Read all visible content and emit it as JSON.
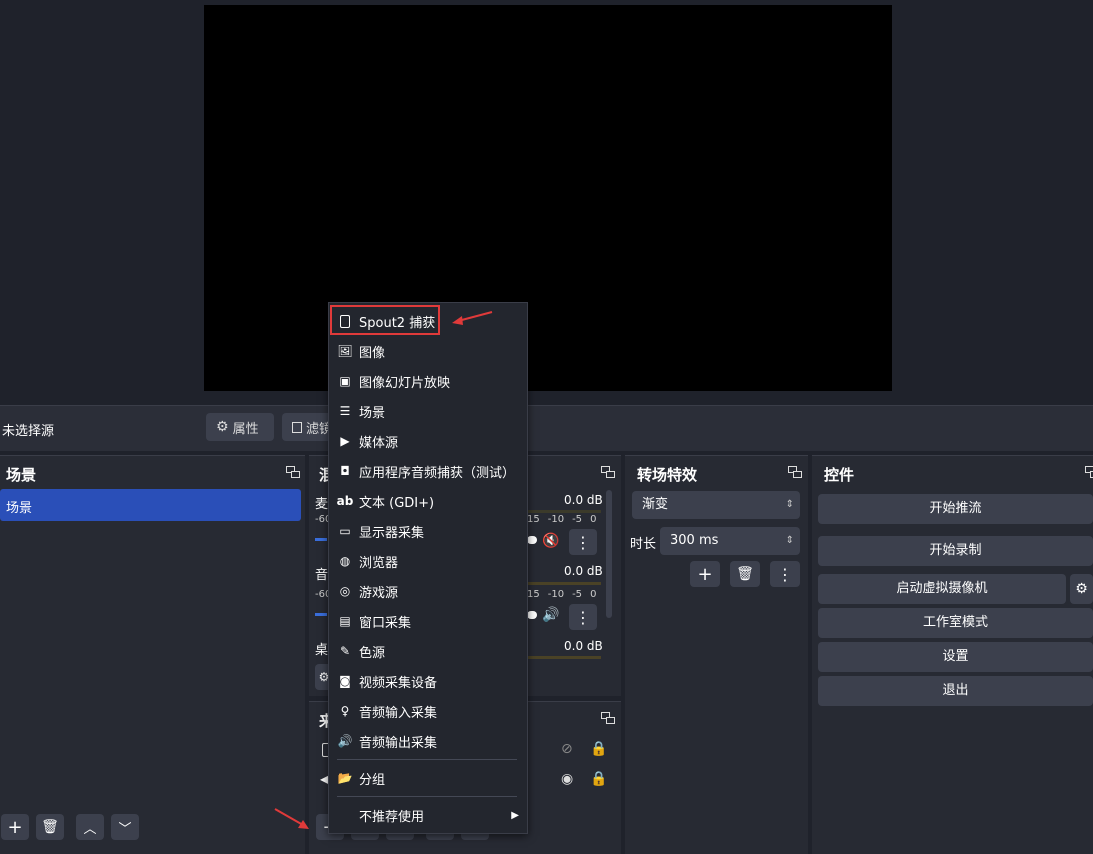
{
  "toolbar": {
    "no_source": "未选择源",
    "properties": "属性",
    "filters": "滤镜"
  },
  "scenes": {
    "title": "场景",
    "items": [
      {
        "label": "场景"
      }
    ]
  },
  "mixer": {
    "title_fragment": "混",
    "channels": [
      {
        "label_fragment": "麦",
        "db": "0.0 dB",
        "scale_left": "-60",
        "scale": [
          "15",
          "-10",
          "-5",
          "0"
        ]
      },
      {
        "label_fragment": "音",
        "db": "0.0 dB",
        "scale_left": "-60",
        "scale": [
          "15",
          "-10",
          "-5",
          "0"
        ]
      },
      {
        "label_fragment": "桌",
        "db": "0.0 dB"
      }
    ]
  },
  "sources": {
    "title_fragment": "来"
  },
  "transitions": {
    "title": "转场特效",
    "selected": "渐变",
    "duration_label": "时长",
    "duration_value": "300 ms"
  },
  "controls": {
    "title": "控件",
    "buttons": [
      "开始推流",
      "开始录制",
      "启动虚拟摄像机",
      "工作室模式",
      "设置",
      "退出"
    ]
  },
  "context_menu": {
    "items": [
      {
        "label": "Spout2 捕获",
        "icon": "file-icon"
      },
      {
        "label": "图像",
        "icon": "image-icon"
      },
      {
        "label": "图像幻灯片放映",
        "icon": "slideshow-icon"
      },
      {
        "label": "场景",
        "icon": "list-icon"
      },
      {
        "label": "媒体源",
        "icon": "play-icon"
      },
      {
        "label": "应用程序音频捕获（测试）",
        "icon": "app-audio-icon"
      },
      {
        "label": "文本 (GDI+)",
        "icon": "text-icon"
      },
      {
        "label": "显示器采集",
        "icon": "monitor-icon"
      },
      {
        "label": "浏览器",
        "icon": "globe-icon"
      },
      {
        "label": "游戏源",
        "icon": "gamepad-icon"
      },
      {
        "label": "窗口采集",
        "icon": "window-icon"
      },
      {
        "label": "色源",
        "icon": "brush-icon"
      },
      {
        "label": "视频采集设备",
        "icon": "camera-icon"
      },
      {
        "label": "音频输入采集",
        "icon": "microphone-icon"
      },
      {
        "label": "音频输出采集",
        "icon": "speaker-icon"
      }
    ],
    "group": {
      "label": "分组",
      "icon": "folder-icon"
    },
    "deprecated": {
      "label": "不推荐使用"
    }
  },
  "colors": {
    "selection": "#2a4fb8",
    "highlight_box": "#e03a3a",
    "arrow": "#e03a3a"
  }
}
